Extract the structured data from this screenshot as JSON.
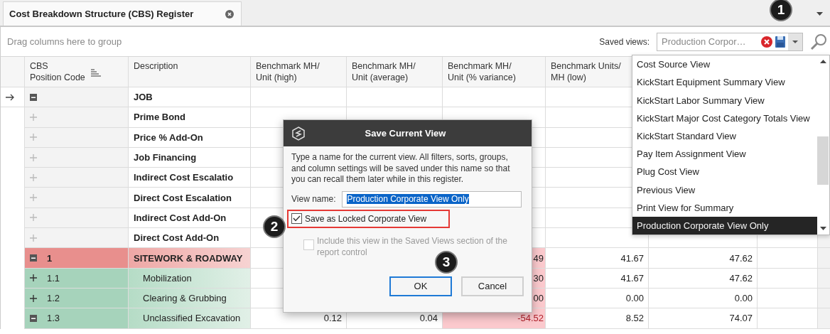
{
  "tab": {
    "title": "Cost Breakdown Structure (CBS) Register",
    "closable": true
  },
  "toolbar": {
    "group_hint": "Drag columns here to group",
    "saved_views_label": "Saved views:",
    "saved_views_value": "Production Corpor…"
  },
  "columns": [
    {
      "label": "CBS\nPosition Code",
      "sorted": true
    },
    {
      "label": "Description",
      "sorted": false
    },
    {
      "label": "Benchmark MH/\nUnit (high)",
      "sorted": false
    },
    {
      "label": "Benchmark MH/\nUnit (average)",
      "sorted": false
    },
    {
      "label": "Benchmark MH/\nUnit (% variance)",
      "sorted": false
    },
    {
      "label": "Benchmark Units/\nMH (low)",
      "sorted": false
    }
  ],
  "rows": [
    {
      "kind": "job",
      "current": true,
      "expanded": true,
      "code": "",
      "description": "JOB",
      "cells": [
        "",
        "",
        "",
        "",
        "",
        ""
      ],
      "flagged": false
    },
    {
      "kind": "job",
      "current": false,
      "expanded": false,
      "code": "",
      "description": "Prime Bond",
      "cells": [
        "",
        "",
        "",
        "",
        "",
        ""
      ],
      "flagged": false
    },
    {
      "kind": "job",
      "current": false,
      "expanded": false,
      "code": "",
      "description": "Price % Add-On",
      "cells": [
        "",
        "",
        "",
        "",
        "",
        ""
      ],
      "flagged": false
    },
    {
      "kind": "job",
      "current": false,
      "expanded": false,
      "code": "",
      "description": "Job Financing",
      "cells": [
        "",
        "",
        "",
        "",
        "",
        ""
      ],
      "flagged": false
    },
    {
      "kind": "job",
      "current": false,
      "expanded": false,
      "code": "",
      "description": "Indirect Cost Escalatio",
      "cells": [
        "",
        "",
        "",
        "",
        "",
        ""
      ],
      "flagged": false
    },
    {
      "kind": "job",
      "current": false,
      "expanded": false,
      "code": "",
      "description": "Direct Cost Escalation",
      "cells": [
        "",
        "",
        "",
        "",
        "",
        ""
      ],
      "flagged": false
    },
    {
      "kind": "job",
      "current": false,
      "expanded": false,
      "code": "",
      "description": "Indirect Cost Add-On",
      "cells": [
        "",
        "",
        "",
        "",
        "",
        ""
      ],
      "flagged": false
    },
    {
      "kind": "job",
      "current": false,
      "expanded": false,
      "code": "",
      "description": "Direct Cost Add-On",
      "cells": [
        "",
        "",
        "",
        "",
        "",
        ""
      ],
      "flagged": false
    },
    {
      "kind": "section",
      "current": false,
      "expanded": true,
      "code": "1",
      "description": "SITEWORK & ROADWAY",
      "cells": [
        "",
        "",
        "49",
        "41.67",
        "47.62",
        ""
      ],
      "flagged": true
    },
    {
      "kind": "item",
      "current": false,
      "expanded": false,
      "code": "1.1",
      "description": "Mobilization",
      "cells": [
        "",
        "",
        "30",
        "41.67",
        "47.62",
        ""
      ],
      "flagged": true
    },
    {
      "kind": "item",
      "current": false,
      "expanded": false,
      "code": "1.2",
      "description": "Clearing & Grubbing",
      "cells": [
        "",
        "",
        "00",
        "0.00",
        "0.00",
        ""
      ],
      "flagged": true
    },
    {
      "kind": "item",
      "current": false,
      "expanded": true,
      "code": "1.3",
      "description": "Unclassified Excavation",
      "cells": [
        "0.12",
        "0.04",
        "-54.52",
        "8.52",
        "74.07",
        ""
      ],
      "flagged": true
    }
  ],
  "dropdown": {
    "items": [
      {
        "label": "Cost Source View",
        "selected": false
      },
      {
        "label": "KickStart Equipment Summary View",
        "selected": false
      },
      {
        "label": "KickStart Labor Summary View",
        "selected": false
      },
      {
        "label": "KickStart Major Cost Category Totals View",
        "selected": false
      },
      {
        "label": "KickStart Standard View",
        "selected": false
      },
      {
        "label": "Pay Item Assignment View",
        "selected": false
      },
      {
        "label": "Plug Cost View",
        "selected": false
      },
      {
        "label": "Previous View",
        "selected": false
      },
      {
        "label": "Print View for Summary",
        "selected": false
      },
      {
        "label": "Production Corporate View Only",
        "selected": true
      }
    ]
  },
  "dialog": {
    "title": "Save Current View",
    "message": "Type a name for the current view.  All filters, sorts, groups, and column settings will be saved under this name so that you can recall them later while in this register.",
    "view_name_label": "View name:",
    "view_name_value": "Production Corporate View Only",
    "locked": {
      "label": "Save as Locked Corporate View",
      "checked": true
    },
    "include": {
      "label": "Include this view in the Saved Views section of the report control",
      "checked": false,
      "disabled": true
    },
    "buttons": [
      {
        "label": "OK",
        "default": true
      },
      {
        "label": "Cancel",
        "default": false
      }
    ]
  },
  "callouts": [
    "1",
    "2",
    "3"
  ]
}
